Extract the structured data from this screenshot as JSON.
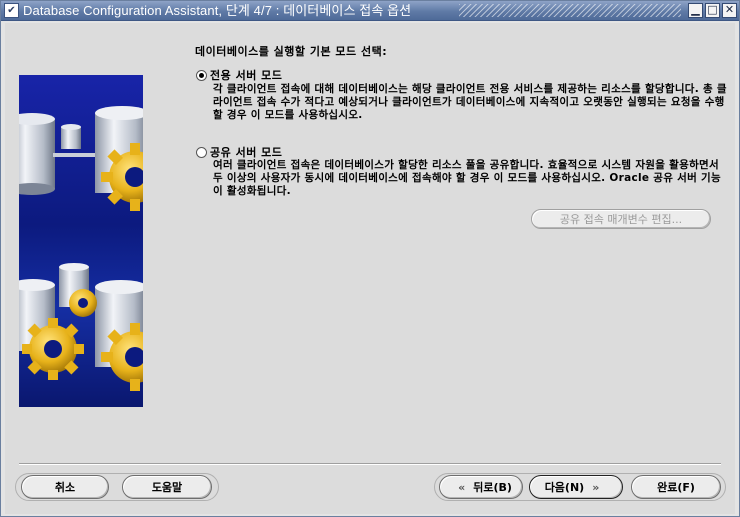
{
  "window": {
    "title": "Database Configuration Assistant, 단계 4/7 : 데이터베이스 접속 옵션",
    "menu_glyph": "✔",
    "minimize_glyph": "▁",
    "maximize_glyph": "□",
    "close_glyph": "✕"
  },
  "main": {
    "section_title": "데이터베이스를 실행할 기본 모드 선택:",
    "dedicated": {
      "label": "전용 서버 모드",
      "selected": true,
      "description": "각 클라이언트 접속에 대해 데이터베이스는 해당 클라이언트 전용 서비스를 제공하는 리소스를 할당합니다. 총 클라이언트 접속 수가 적다고 예상되거나 클라이언트가 데이터베이스에 지속적이고 오랫동안 실행되는 요청을 수행할 경우 이 모드를 사용하십시오."
    },
    "shared": {
      "label": "공유 서버 모드",
      "selected": false,
      "description": "여러 클라이언트 접속은 데이터베이스가 할당한 리소스 풀을 공유합니다. 효율적으로 시스템 자원을 활용하면서 두 이상의 사용자가 동시에 데이터베이스에 접속해야 할 경우 이 모드를 사용하십시오. Oracle 공유 서버 기능이 활성화됩니다."
    },
    "edit_shared_button": "공유 접속 매개변수 편집..."
  },
  "footer": {
    "cancel": "취소",
    "help": "도움말",
    "back": "뒤로(B)",
    "next": "다음(N)",
    "finish": "완료(F)",
    "back_arrow": "«",
    "next_arrow": "»"
  },
  "colors": {
    "titlebar": "#5f7aa6",
    "illustration_blue": "#0c1a7f",
    "gear_gold": "#e7b21a"
  }
}
